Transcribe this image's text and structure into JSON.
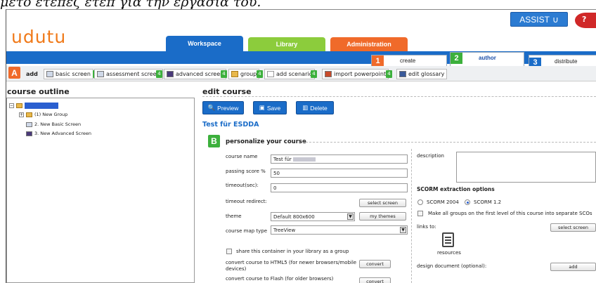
{
  "caption": "μετο ετεπε̄ζ ετεπ για την εργασια του.",
  "app": {
    "logo": "udutu",
    "assist_label": "ASSIST",
    "assist_icon": "headset-icon",
    "help_glyph": "?"
  },
  "main_tabs": [
    {
      "label": "Workspace",
      "color": "#1a6cc8"
    },
    {
      "label": "Library",
      "color": "#8ccc3c"
    },
    {
      "label": "Administration",
      "color": "#f06a2a"
    }
  ],
  "sub_tabs": [
    {
      "num": "1",
      "label": "create",
      "color": "#f06a2a"
    },
    {
      "num": "2",
      "label": "author",
      "color": "#3cb03c"
    },
    {
      "num": "3",
      "label": "distribute",
      "color": "#1a6cc8"
    }
  ],
  "add_bar": {
    "badge": "A",
    "label": "add",
    "items": [
      {
        "label": "basic screen",
        "icon": "screen-icon"
      },
      {
        "label": "assessment screen",
        "icon": "assessment-icon"
      },
      {
        "label": "advanced screen",
        "icon": "advanced-screen-icon"
      },
      {
        "label": "group",
        "icon": "folder-icon"
      },
      {
        "label": "add scenario",
        "icon": "scenario-icon"
      },
      {
        "label": "import powerpoint",
        "icon": "powerpoint-icon"
      },
      {
        "label": "edit glossary",
        "icon": "glossary-icon"
      }
    ],
    "count_badge": "4"
  },
  "outline": {
    "title": "course outline",
    "items": [
      {
        "label": "(1) New Group"
      },
      {
        "label": "2. New Basic Screen"
      },
      {
        "label": "3. New Advanced Screen"
      }
    ]
  },
  "edit": {
    "title": "edit course",
    "buttons": {
      "preview": "Preview",
      "save": "Save",
      "delete": "Delete"
    },
    "course_title": "Test für ESDDA",
    "section_badge": "B",
    "section_title": "personalize your course",
    "fields": {
      "course_name_label": "course name",
      "course_name_value": "Test für",
      "passing_label": "passing score %",
      "passing_value": "50",
      "timeout_label": "timeout(sec):",
      "timeout_value": "0",
      "redirect_label": "timeout redirect:",
      "select_screen": "select screen",
      "theme_label": "theme",
      "theme_value": "Default 800x600",
      "my_themes": "my themes",
      "map_label": "course map type",
      "map_value": "TreeView",
      "share_label": "share this container in your library as a group",
      "html5_label": "convert course to HTML5 (for newer browsers/mobile devices)",
      "flash_label": "convert course to Flash (for older browsers)",
      "convert": "convert"
    },
    "right": {
      "description_label": "description",
      "scorm_title": "SCORM extraction options",
      "scorm_2004": "SCORM 2004",
      "scorm_12": "SCORM 1.2",
      "sco_label": "Make all groups on the first level of this course into separate SCOs",
      "links_label": "links to:",
      "select_screen": "select screen",
      "resources": "resources",
      "design_doc_label": "design document (optional):",
      "add": "add"
    }
  }
}
